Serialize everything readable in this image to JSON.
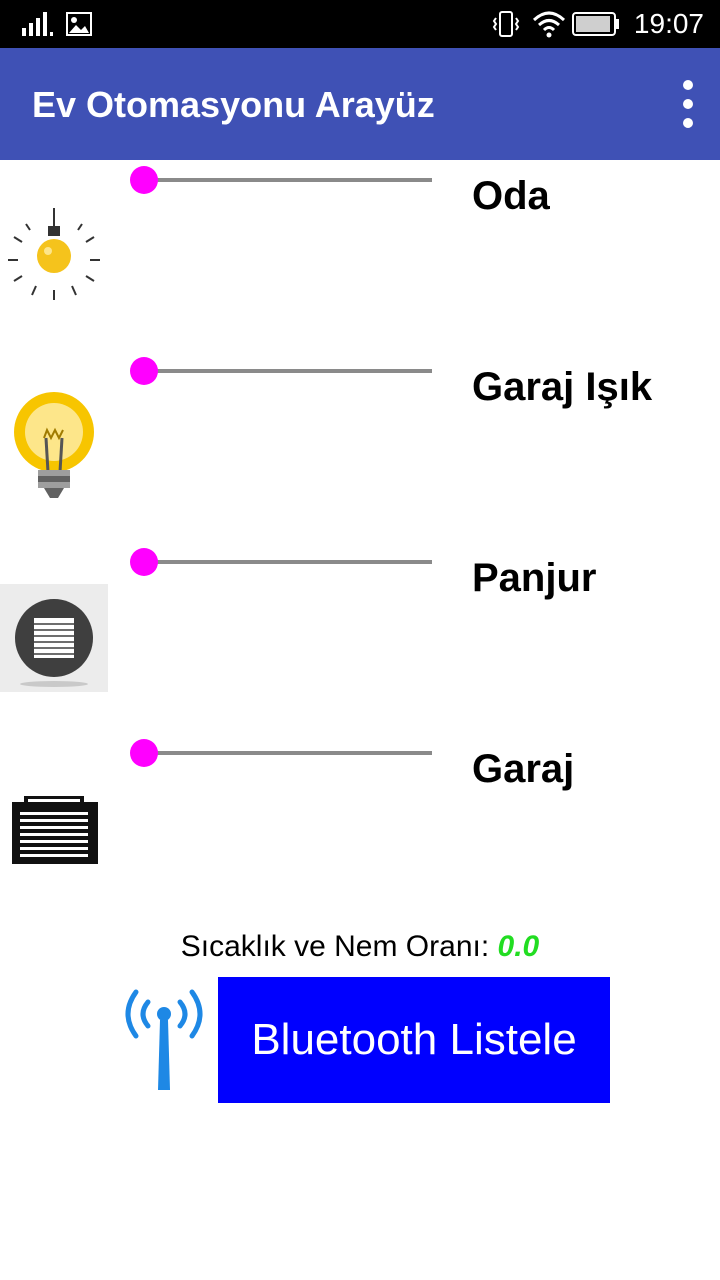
{
  "status_bar": {
    "time": "19:07",
    "icons": [
      "signal-icon",
      "image-notification-icon",
      "vibrate-icon",
      "wifi-icon",
      "battery-icon"
    ]
  },
  "app_bar": {
    "title": "Ev Otomasyonu Arayüz",
    "menu_icon": "overflow-menu-icon",
    "color": "#3F51B5"
  },
  "controls": [
    {
      "label": "Oda",
      "icon": "lightbulb-icon",
      "slider_value": 0
    },
    {
      "label": "Garaj Işık",
      "icon": "yellow-bulb-icon",
      "slider_value": 0
    },
    {
      "label": "Panjur",
      "icon": "blinds-icon",
      "slider_value": 0
    },
    {
      "label": "Garaj",
      "icon": "garage-door-icon",
      "slider_value": 0
    }
  ],
  "slider_colors": {
    "thumb": "#FF00FF",
    "track": "#8A8A8A"
  },
  "sensor": {
    "label": "Sıcaklık ve Nem Oranı:",
    "value": "0.0",
    "value_color": "#22DD22"
  },
  "bluetooth": {
    "icon": "antenna-icon",
    "button_label": "Bluetooth Listele",
    "button_color": "#0000FF"
  }
}
